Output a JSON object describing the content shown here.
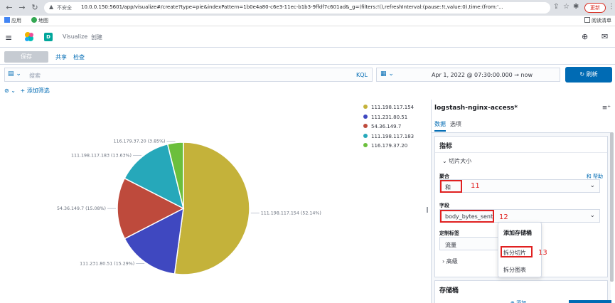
{
  "browser": {
    "insecure_label": "不安全",
    "url": "10.0.0.150:5601/app/visualize#/create?type=pie&indexPattern=1b0e4a80-c6e3-11ec-b1b3-9ffdf7c601ad&_g=(filters:!(),refreshInterval:(pause:!t,value:0),time:(from:'...",
    "update_label": "更新",
    "bookmarks": {
      "apps": "应用",
      "maps": "地图",
      "reading": "阅读清单"
    }
  },
  "header": {
    "space_letter": "D",
    "breadcrumb_app": "Visualize",
    "breadcrumb_page": "创建"
  },
  "toolbar": {
    "save": "保存",
    "share": "共享",
    "inspect": "检查"
  },
  "query": {
    "placeholder": "搜索",
    "kql": "KQL"
  },
  "time": {
    "range": "Apr 1, 2022 @ 07:30:00.000  →  now"
  },
  "refresh": {
    "label": "刷新"
  },
  "filter": {
    "add": "+ 添加筛选"
  },
  "chart_data": {
    "type": "pie",
    "title": "",
    "slices": [
      {
        "label": "111.198.117.154",
        "percent": 52.14,
        "color": "#C4B23A",
        "callout": "111.198.117.154 (52.14%)"
      },
      {
        "label": "111.231.80.51",
        "percent": 15.29,
        "color": "#3F48C0",
        "callout": "111.231.80.51 (15.29%)"
      },
      {
        "label": "54.36.149.7",
        "percent": 15.08,
        "color": "#BE4A3C",
        "callout": "54.36.149.7 (15.08%)"
      },
      {
        "label": "111.198.117.183",
        "percent": 13.63,
        "color": "#26A8BA",
        "callout": "111.198.117.183 (13.63%)"
      },
      {
        "label": "116.179.37.20",
        "percent": 3.85,
        "color": "#6BBF3C",
        "callout": "116.179.37.20 (3.85%)"
      }
    ],
    "legend": [
      "111.198.117.154",
      "111.231.80.51",
      "54.36.149.7",
      "111.198.117.183",
      "116.179.37.20"
    ],
    "legend_position": "right"
  },
  "panel": {
    "title": "logstash-nginx-access*",
    "tab_data": "数据",
    "tab_options": "选项",
    "metrics_heading": "指标",
    "slice_size": "切片大小",
    "agg_label": "聚合",
    "agg_help": "和 帮助",
    "agg_value": "和",
    "field_label": "字段",
    "field_value": "body_bytes_sent",
    "custom_label_label": "定制标签",
    "custom_label_value": "流量",
    "advanced": "高级",
    "buckets_heading": "存储桶",
    "add_link": "添加",
    "popup_title": "添加存储桶",
    "popup_split_slices": "拆分切片",
    "popup_split_chart": "拆分图表"
  },
  "annotations": {
    "a11": "11",
    "a12": "12",
    "a13": "13"
  }
}
